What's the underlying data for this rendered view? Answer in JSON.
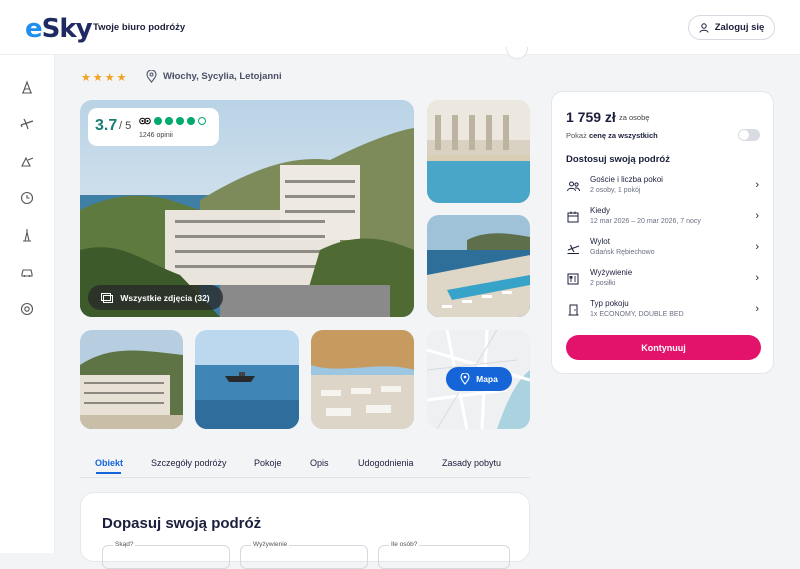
{
  "header": {
    "logo_text": "eSky",
    "tagline": "Twoje biuro podróży",
    "login_label": "Zaloguj się"
  },
  "sidebar": {
    "items": [
      "hotel-icon",
      "flight-icon",
      "flight-hotel-icon",
      "last-minute-icon",
      "tour-icon",
      "car-icon",
      "support-icon"
    ]
  },
  "hotel": {
    "stars": "★★★★",
    "location": "Włochy, Sycylia, Letojanni",
    "rating_score": "3.7",
    "rating_of": "/ 5",
    "reviews": "1246 opinii",
    "all_photos": "Wszystkie zdjęcia (32)",
    "map_label": "Mapa"
  },
  "tabs": [
    {
      "label": "Obiekt"
    },
    {
      "label": "Szczegóły podróży"
    },
    {
      "label": "Pokoje"
    },
    {
      "label": "Opis"
    },
    {
      "label": "Udogodnienia"
    },
    {
      "label": "Zasady pobytu"
    }
  ],
  "adjust": {
    "title": "Dopasuj swoją podróż",
    "fields": [
      "Skąd?",
      "Wyżywienie",
      "Ile osób?"
    ]
  },
  "booking": {
    "price": "1 759 zł",
    "per_person": "za osobę",
    "show_prefix": "Pokaż",
    "show_bold": "cenę za wszystkich",
    "heading": "Dostosuj swoją podróż",
    "options": [
      {
        "title": "Goście i liczba pokoi",
        "sub": "2 osoby, 1 pokój"
      },
      {
        "title": "Kiedy",
        "sub": "12 mar 2026 – 20 mar 2026, 7 nocy"
      },
      {
        "title": "Wylot",
        "sub": "Gdańsk Rębiechowo"
      },
      {
        "title": "Wyżywienie",
        "sub": "2 posiłki"
      },
      {
        "title": "Typ pokoju",
        "sub": "1x ECONOMY, DOUBLE BED"
      }
    ],
    "cta": "Kontynuuj"
  },
  "colors": {
    "accent": "#e3126b",
    "link": "#1565d8",
    "rating": "#00aa6c"
  }
}
